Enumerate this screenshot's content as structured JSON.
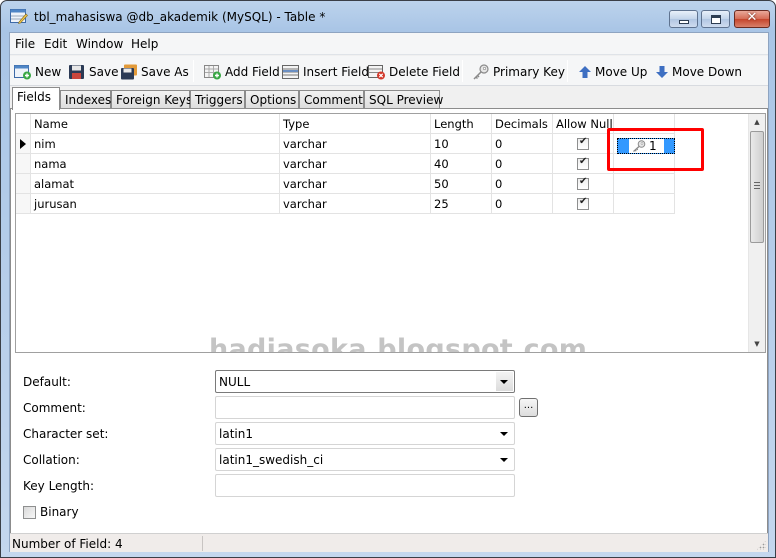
{
  "window": {
    "title": "tbl_mahasiswa @db_akademik (MySQL) - Table *",
    "controls": {
      "minimize": "minimize",
      "maximize": "maximize",
      "close": "✕"
    }
  },
  "menu": [
    "File",
    "Edit",
    "Window",
    "Help"
  ],
  "toolbar": {
    "new": "New",
    "save": "Save",
    "save_as": "Save As",
    "add_field": "Add Field",
    "insert_field": "Insert Field",
    "delete_field": "Delete Field",
    "primary_key": "Primary Key",
    "move_up": "Move Up",
    "move_down": "Move Down"
  },
  "tabs": [
    "Fields",
    "Indexes",
    "Foreign Keys",
    "Triggers",
    "Options",
    "Comment",
    "SQL Preview"
  ],
  "active_tab": "Fields",
  "grid": {
    "columns": [
      "Name",
      "Type",
      "Length",
      "Decimals",
      "Allow Null",
      ""
    ],
    "rows": [
      {
        "name": "nim",
        "type": "varchar",
        "length": "10",
        "decimals": "0",
        "allow_null": true,
        "key": "1",
        "current": true
      },
      {
        "name": "nama",
        "type": "varchar",
        "length": "40",
        "decimals": "0",
        "allow_null": true,
        "key": ""
      },
      {
        "name": "alamat",
        "type": "varchar",
        "length": "50",
        "decimals": "0",
        "allow_null": true,
        "key": ""
      },
      {
        "name": "jurusan",
        "type": "varchar",
        "length": "25",
        "decimals": "0",
        "allow_null": true,
        "key": ""
      }
    ],
    "primary_key_index": "1",
    "highlight_color": "#ff0000",
    "selection_color": "#3399ff"
  },
  "watermark": "hadiasoka.blogspot.com",
  "properties": {
    "default_label": "Default:",
    "default_value": "NULL",
    "comment_label": "Comment:",
    "comment_value": "",
    "comment_button": "...",
    "charset_label": "Character set:",
    "charset_value": "latin1",
    "collation_label": "Collation:",
    "collation_value": "latin1_swedish_ci",
    "key_length_label": "Key Length:",
    "key_length_value": "",
    "binary_label": "Binary",
    "binary_checked": false
  },
  "status": {
    "text": "Number of Field: 4"
  }
}
